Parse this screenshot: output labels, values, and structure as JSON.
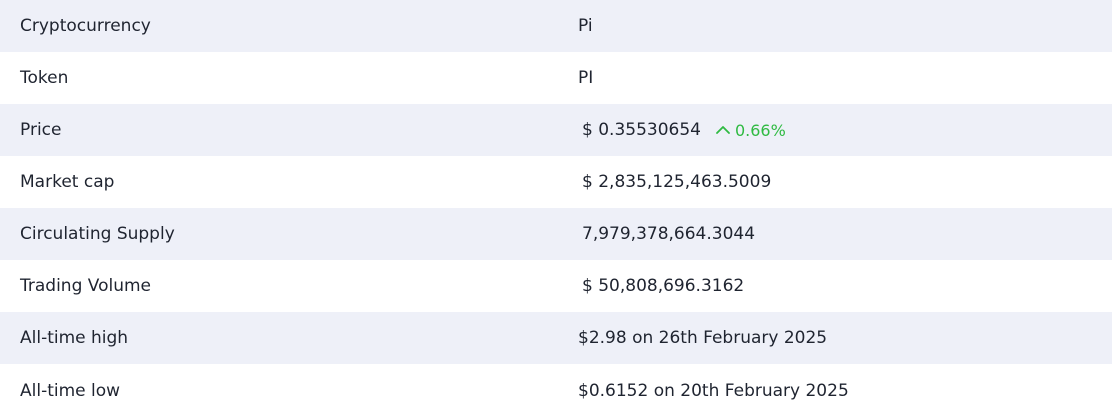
{
  "rows": [
    {
      "label": "Cryptocurrency",
      "value": "Pi"
    },
    {
      "label": "Token",
      "value": "PI"
    },
    {
      "label": "Price",
      "value": "$ 0.35530654",
      "change": "0.66%"
    },
    {
      "label": "Market cap",
      "value": "$ 2,835,125,463.5009"
    },
    {
      "label": "Circulating Supply",
      "value": "7,979,378,664.3044"
    },
    {
      "label": "Trading Volume",
      "value": "$ 50,808,696.3162"
    },
    {
      "label": "All-time high",
      "value": "$2.98 on 26th February 2025"
    },
    {
      "label": "All-time low",
      "value": "$0.6152 on 20th February 2025"
    }
  ],
  "colors": {
    "row_shade": "#eef0f8",
    "positive": "#2fba42",
    "text": "#1f2430"
  },
  "icons": {
    "change_direction": "chevron-up-icon"
  }
}
